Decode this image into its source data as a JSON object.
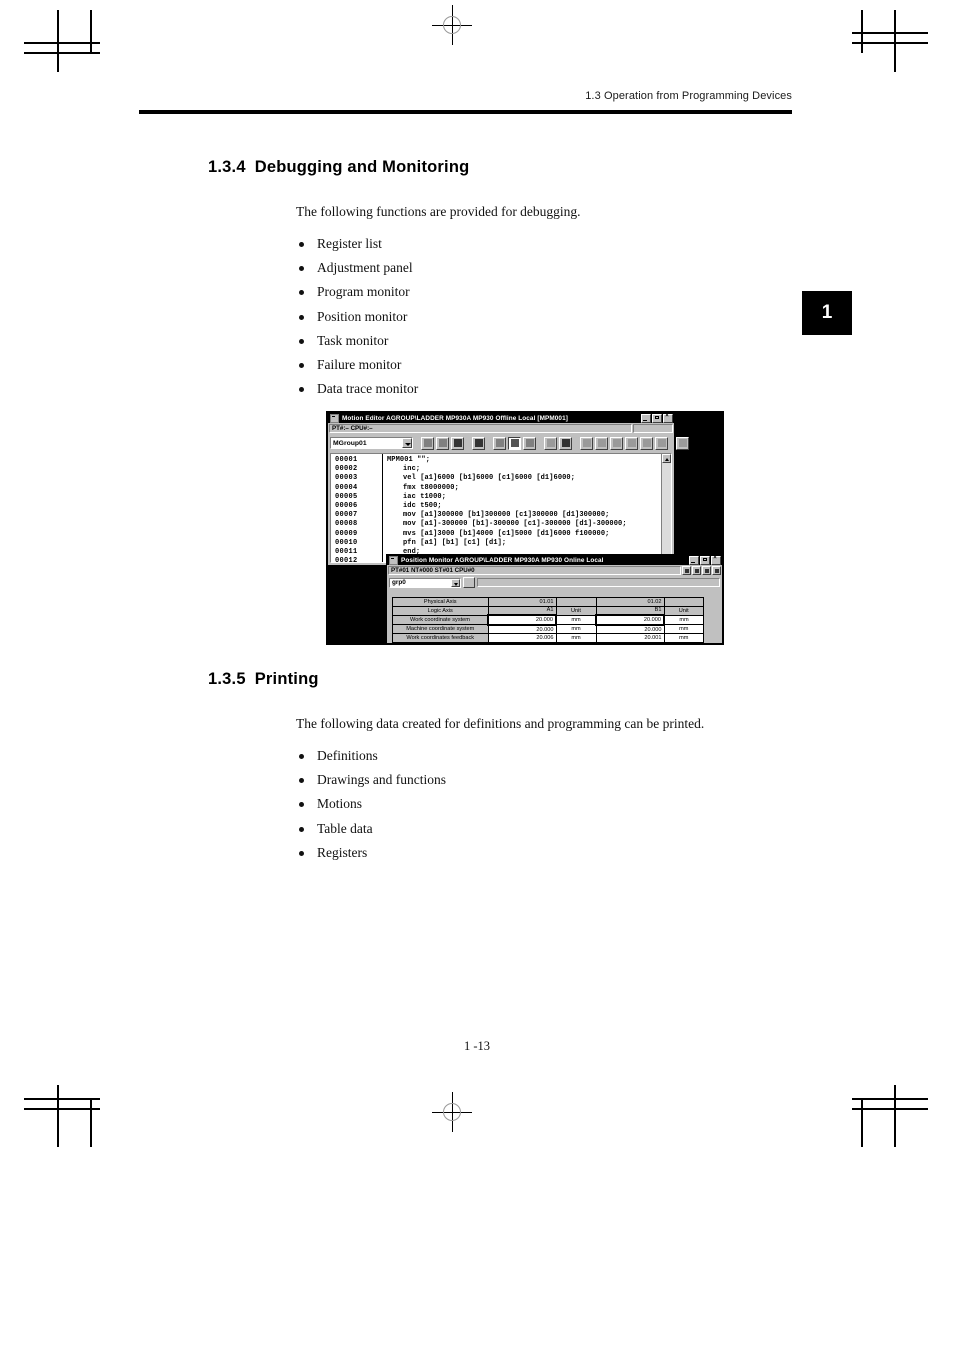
{
  "page": {
    "running_head": "1.3  Operation from Programming Devices",
    "chapter_tab": "1",
    "folio": "1 -13"
  },
  "sections": [
    {
      "number": "1.3.4",
      "title": "Debugging and Monitoring",
      "intro": "The following functions are provided for debugging.",
      "bullets": [
        "Register list",
        "Adjustment panel",
        "Program monitor",
        "Position monitor",
        "Task monitor",
        "Failure monitor",
        "Data trace monitor"
      ]
    },
    {
      "number": "1.3.5",
      "title": "Printing",
      "intro": "The following data created for definitions and programming can be printed.",
      "bullets": [
        "Definitions",
        "Drawings and functions",
        "Motions",
        "Table data",
        "Registers"
      ]
    }
  ],
  "figure": {
    "motion_editor": {
      "title": "Motion Editor   AGROUP\\LADDER  MP930A  MP930     Offline  Local  [MPM001]",
      "status_left": "PT#:– CPU#:–",
      "status_right": "",
      "group_combo": "MGroup01",
      "line_numbers": [
        "00001",
        "00002",
        "00003",
        "00004",
        "00005",
        "00006",
        "00007",
        "00008",
        "00009",
        "00010",
        "00011",
        "00012"
      ],
      "code_lines": [
        {
          "text": "MPM001 \"\";",
          "indent": false,
          "highlight": false
        },
        {
          "text": "inc;",
          "indent": true,
          "highlight": false
        },
        {
          "text": "vel [a1]6000 [b1]6000 [c1]6000 [d1]6000;",
          "indent": true,
          "highlight": false
        },
        {
          "text": "fmx t8000000;",
          "indent": true,
          "highlight": false
        },
        {
          "text": "iac t1000;",
          "indent": true,
          "highlight": false
        },
        {
          "text": "idc t500;",
          "indent": true,
          "highlight": false
        },
        {
          "text": "mov [a1]300000 [b1]300000 [c1]300000 [d1]300000;",
          "indent": true,
          "highlight": true
        },
        {
          "text": "mov [a1]-300000 [b1]-300000 [c1]-300000 [d1]-300000;",
          "indent": true,
          "highlight": false
        },
        {
          "text": "mvs [a1]3000 [b1]4000 [c1]5000 [d1]6000 f100000;",
          "indent": true,
          "highlight": false
        },
        {
          "text": "pfn [a1] [b1] [c1] [d1];",
          "indent": true,
          "highlight": false
        },
        {
          "text": "end;",
          "indent": true,
          "highlight": false
        }
      ]
    },
    "position_monitor": {
      "title": "Position Monitor   AGROUP\\LADDER  MP930A  MP930     Online  Local",
      "status_left": "PT#01 NT#000 ST#01 CPU#0",
      "group_combo": "grp0",
      "table": {
        "header_rows": [
          [
            "Physical Axis",
            "01.01",
            "",
            "01.02",
            ""
          ],
          [
            "Logic Axis",
            "A1",
            "Unit",
            "B1",
            "Unit"
          ]
        ],
        "rows": [
          {
            "label": "Work coordinate system",
            "v1": "20.000",
            "u1": "mm",
            "v2": "20.000",
            "u2": "mm",
            "selected": true
          },
          {
            "label": "Machine coordinate system",
            "v1": "20.000",
            "u1": "mm",
            "v2": "20.000",
            "u2": "mm",
            "selected": false
          },
          {
            "label": "Work coordinates feedback",
            "v1": "20.006",
            "u1": "mm",
            "v2": "20.001",
            "u2": "mm",
            "selected": false
          }
        ]
      }
    },
    "window_buttons": {
      "minimize": "minimize-icon",
      "maximize": "maximize-icon",
      "close": "close-icon"
    }
  }
}
